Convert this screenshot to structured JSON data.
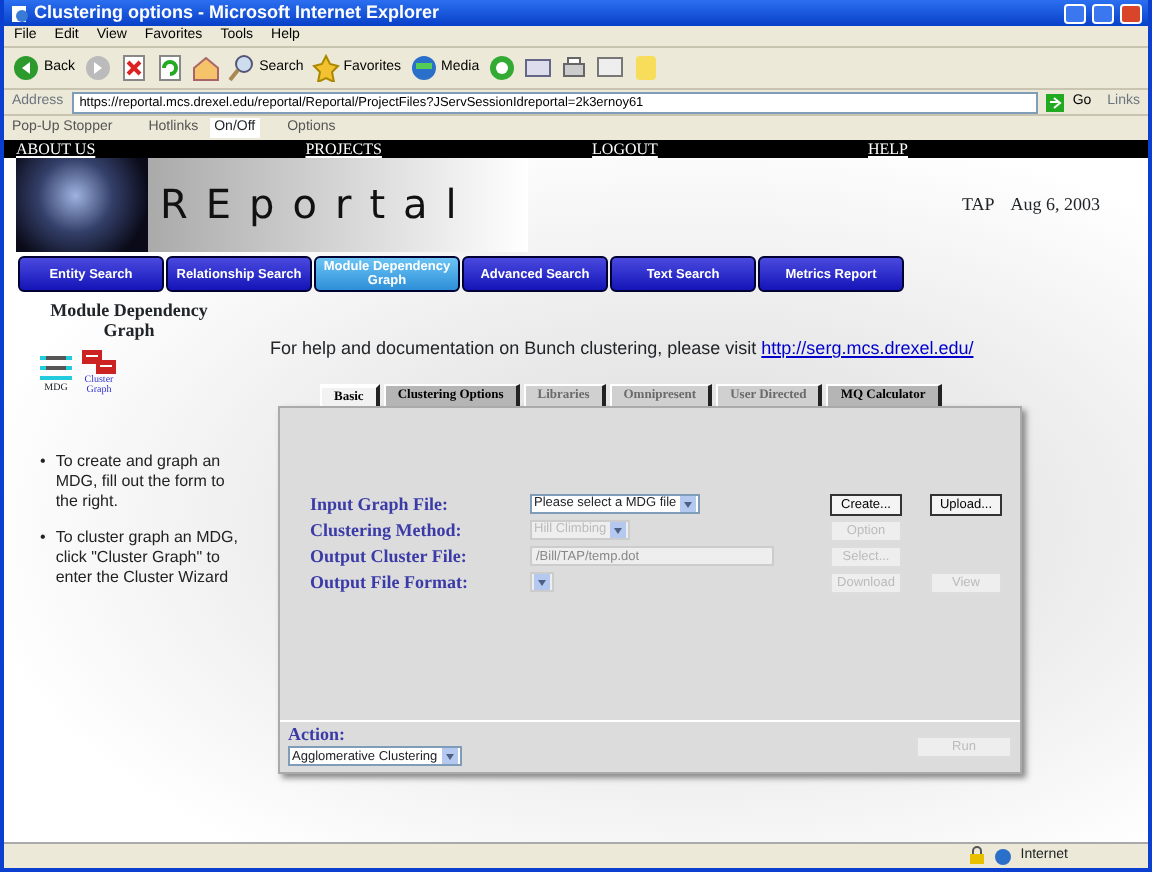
{
  "window": {
    "title": "Clustering options - Microsoft Internet Explorer"
  },
  "menu_bar": [
    "File",
    "Edit",
    "View",
    "Favorites",
    "Tools",
    "Help"
  ],
  "toolbar": [
    {
      "kind": "back",
      "label": "Back"
    },
    {
      "kind": "forward"
    },
    {
      "kind": "stop"
    },
    {
      "kind": "refresh"
    },
    {
      "kind": "home"
    },
    {
      "kind": "search",
      "label": "Search"
    },
    {
      "kind": "favorites",
      "label": "Favorites"
    },
    {
      "kind": "media",
      "label": "Media"
    },
    {
      "kind": "history"
    },
    {
      "kind": "mail"
    },
    {
      "kind": "print"
    },
    {
      "kind": "edit"
    },
    {
      "kind": "note"
    }
  ],
  "address_bar": {
    "label": "Address",
    "value": "https://reportal.mcs.drexel.edu/reportal/Reportal/ProjectFiles?JServSessionIdreportal=2k3ernoy61",
    "go": "Go",
    "links": "Links"
  },
  "popup_stopper": {
    "label": "Pop-Up Stopper",
    "hotlinks": "Hotlinks",
    "toggle": "On/Off",
    "options": "Options"
  },
  "top_links": [
    "ABOUT US",
    "PROJECTS",
    "LOGOUT",
    "HELP"
  ],
  "banner": {
    "logo": "REportal",
    "user": "TAP",
    "date": "Aug 6, 2003"
  },
  "nav_buttons": [
    {
      "label": "Entity Search",
      "selected": false
    },
    {
      "label": "Relationship Search",
      "selected": false
    },
    {
      "label": "Module Dependency Graph",
      "selected": true
    },
    {
      "label": "Advanced Search",
      "selected": false
    },
    {
      "label": "Text Search",
      "selected": false
    },
    {
      "label": "Metrics Report",
      "selected": false
    }
  ],
  "sidebar": {
    "title": "Module Dependency Graph",
    "icon_labels": [
      "MDG",
      "Cluster Graph"
    ],
    "bullets": [
      {
        "marker": "•",
        "text": "To create and graph an MDG, fill out the form to the right."
      },
      {
        "marker": "•",
        "text": "To cluster graph an MDG, click \"Cluster Graph\" to enter the Cluster Wizard"
      }
    ]
  },
  "help": {
    "text": "For help and documentation on Bunch clustering, please visit",
    "link": "http://serg.mcs.drexel.edu/"
  },
  "tabs": [
    {
      "label": "Basic",
      "selected": true,
      "disabled": false
    },
    {
      "label": "Clustering Options",
      "selected": false,
      "disabled": false
    },
    {
      "label": "Libraries",
      "selected": false,
      "disabled": true
    },
    {
      "label": "Omnipresent",
      "selected": false,
      "disabled": true
    },
    {
      "label": "User Directed",
      "selected": false,
      "disabled": true
    },
    {
      "label": "MQ Calculator",
      "selected": false,
      "disabled": false
    }
  ],
  "form_rows": [
    {
      "label": "Input Graph File:",
      "kind": "select",
      "value": "Please select a MDG file",
      "disabled": false,
      "buttons": [
        {
          "label": "Create...",
          "disabled": false
        },
        {
          "label": "Upload...",
          "disabled": false
        }
      ]
    },
    {
      "label": "Clustering Method:",
      "kind": "select",
      "value": "Hill Climbing",
      "disabled": true,
      "buttons": [
        {
          "label": "Option",
          "disabled": true
        }
      ]
    },
    {
      "label": "Output Cluster File:",
      "kind": "text",
      "value": "/Bill/TAP/temp.dot",
      "disabled": true,
      "buttons": [
        {
          "label": "Select...",
          "disabled": true
        }
      ]
    },
    {
      "label": "Output File Format:",
      "kind": "select",
      "disabled": true,
      "buttons": [
        {
          "label": "Download",
          "disabled": true
        },
        {
          "label": "View",
          "disabled": true
        }
      ]
    }
  ],
  "action": {
    "label": "Action:",
    "value": "Agglomerative Clustering",
    "run": {
      "label": "Run",
      "disabled": true
    }
  },
  "status_bar": {
    "zone": "Internet"
  }
}
